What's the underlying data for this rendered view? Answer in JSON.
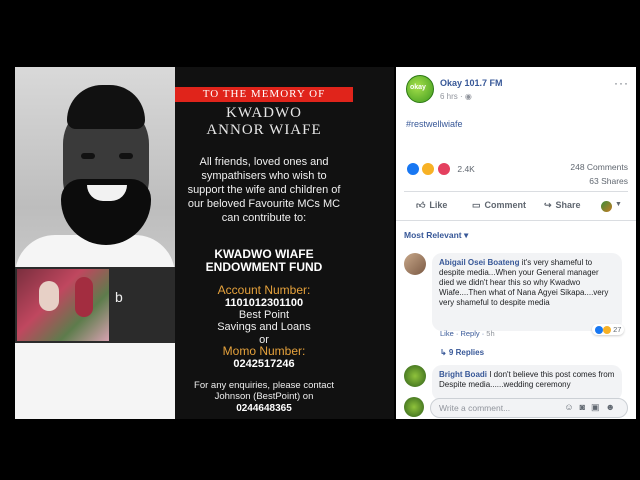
{
  "flyer": {
    "banner": "TO THE MEMORY OF",
    "name_line1": "KWADWO",
    "name_line2": "ANNOR WIAFE",
    "body": "All friends, loved ones and sympathisers who wish to support the wife and children of our beloved Favourite MCs MC can contribute to:",
    "fund_line1": "KWADWO WIAFE",
    "fund_line2": "ENDOWMENT FUND",
    "account_heading": "Account Number:",
    "account_number": "1101012301100",
    "bank_line1": "Best Point",
    "bank_line2": "Savings and Loans",
    "or": "or",
    "momo_heading": "Momo Number:",
    "momo_number": "0242517246",
    "enquiries": "For any enquiries, please contact Johnson (BestPoint) on",
    "enquiries_number": "0244648365"
  },
  "post": {
    "page_name": "Okay 101.7 FM",
    "avatar_text": "okay",
    "time": "6 hrs · ",
    "more": "···",
    "hashtag": "#restwellwiafe",
    "reaction_count": "2.4K",
    "comments_count": "248 Comments",
    "shares_count": "63 Shares",
    "actions": {
      "like": "Like",
      "comment": "Comment",
      "share": "Share"
    },
    "sort_label": "Most Relevant ▾"
  },
  "comments": [
    {
      "author": "Abigail Osei Boateng",
      "text": " it's very shameful to despite media...When your General manager died we didn't hear this so why Kwadwo Wiafe....Then what of Nana Agyei Sikapa....very very shameful to despite media",
      "like": "Like",
      "reply": "Reply",
      "time": "5h",
      "reaction_count": "27",
      "replies": "↳ 9 Replies"
    },
    {
      "author": "Bright Boadi",
      "text": " I don't believe this post comes from Despite media......wedding ceremony"
    }
  ],
  "composer": {
    "placeholder": "Write a comment..."
  }
}
